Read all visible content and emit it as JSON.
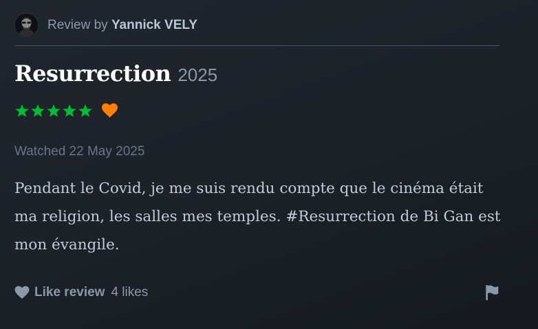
{
  "header": {
    "review_prefix": "Review by",
    "reviewer_name": "Yannick VELY"
  },
  "film": {
    "title": "Resurrection",
    "year": "2025"
  },
  "rating": {
    "stars": 5,
    "max": 5,
    "liked": true,
    "star_color": "#00c030",
    "heart_color": "#ff8000"
  },
  "watched": "Watched 22 May 2025",
  "review": {
    "text": "Pendant le Covid, je me suis rendu compte que le cinéma était ma religion, les salles mes temples. #Resurrection de Bi Gan est mon évangile."
  },
  "footer": {
    "like_label": "Like review",
    "likes_count": "4 likes"
  },
  "colors": {
    "background": "#1c2228",
    "title": "#ffffff",
    "muted": "#8899aa",
    "body_text": "#c1ccd6"
  },
  "icons": {
    "avatar": "avatar",
    "star": "star-icon",
    "liked_heart": "heart-icon",
    "like_heart": "heart-icon",
    "report": "flag-icon"
  }
}
